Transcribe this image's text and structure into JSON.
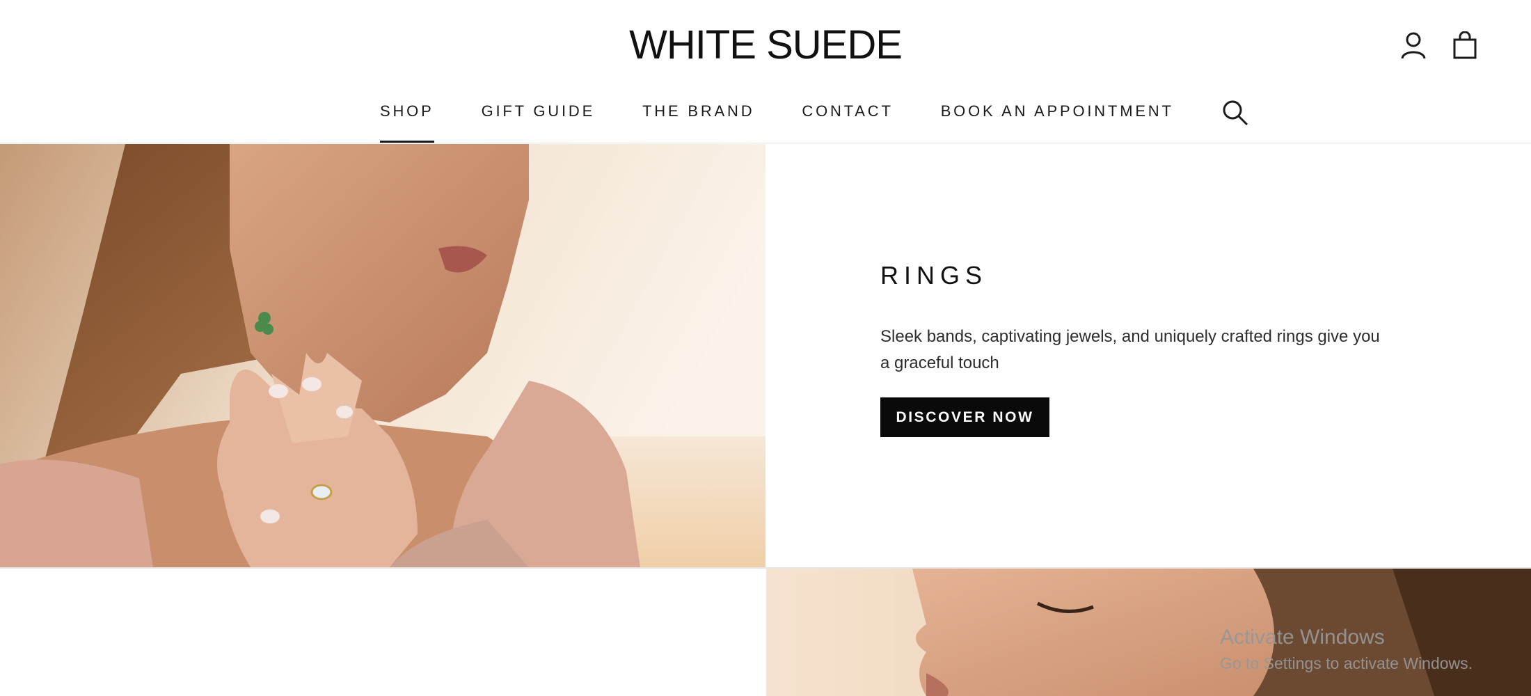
{
  "brand": {
    "logo_text": "WHITE SUEDE"
  },
  "header": {
    "icons": [
      "user-account-icon",
      "shopping-bag-icon"
    ]
  },
  "nav": {
    "items": [
      {
        "label": "SHOP",
        "active": true
      },
      {
        "label": "GIFT GUIDE",
        "active": false
      },
      {
        "label": "THE BRAND",
        "active": false
      },
      {
        "label": "CONTACT",
        "active": false
      },
      {
        "label": "BOOK AN APPOINTMENT",
        "active": false
      }
    ],
    "search_icon": "search-icon"
  },
  "hero": {
    "title": "RINGS",
    "description": "Sleek bands, captivating jewels, and uniquely crafted rings give you a graceful touch",
    "cta_label": "DISCOVER NOW"
  },
  "os_overlay": {
    "title": "Activate Windows",
    "subtitle": "Go to Settings to activate Windows."
  },
  "colors": {
    "text": "#1c1b1b",
    "button_bg": "#0a0a0a",
    "button_text": "#ffffff",
    "divider": "#e3e3e3"
  }
}
